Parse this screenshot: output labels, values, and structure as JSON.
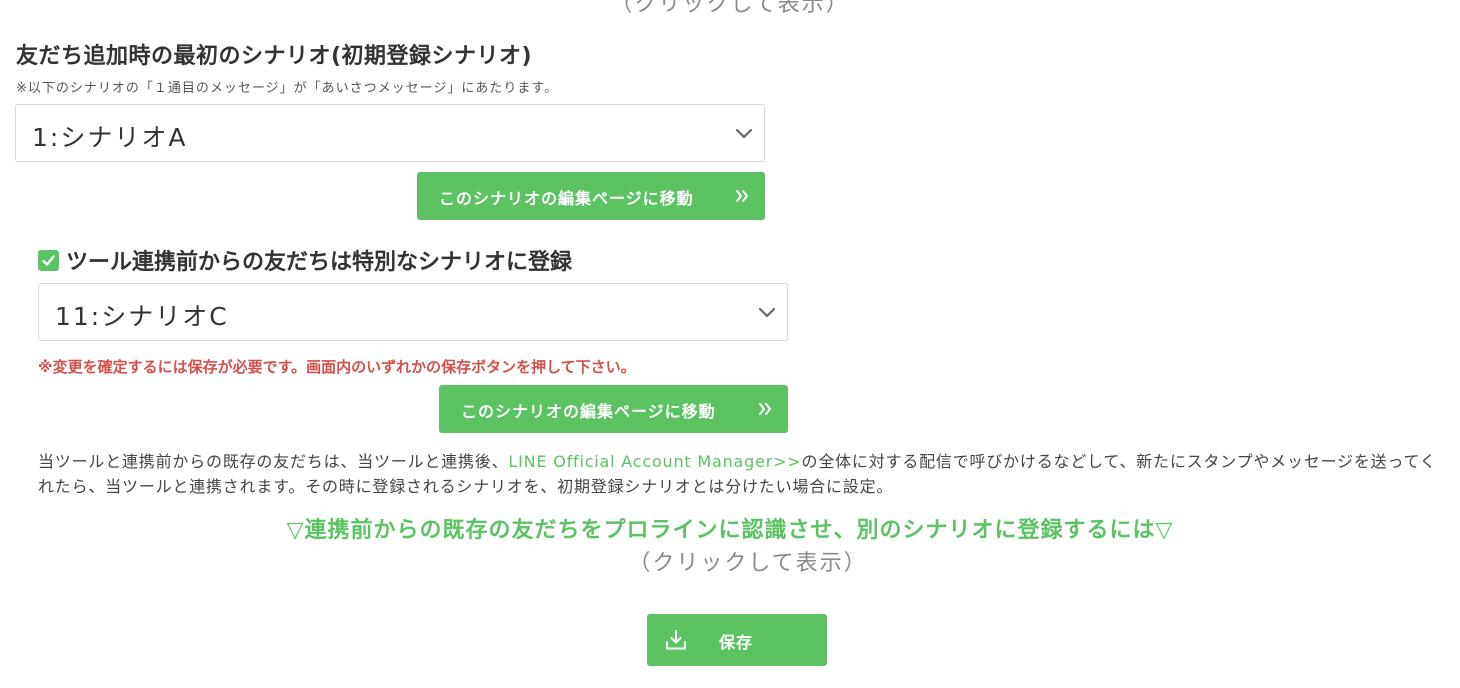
{
  "top_partial_text": "（クリックして表示）",
  "initial_scenario": {
    "title": "友だち追加時の最初のシナリオ(初期登録シナリオ)",
    "note": "※以下のシナリオの「１通目のメッセージ」が「あいさつメッセージ」にあたります。",
    "selected": "1:シナリオA",
    "edit_button_label": "このシナリオの編集ページに移動"
  },
  "special_scenario": {
    "checkbox_label": "ツール連携前からの友だちは特別なシナリオに登録",
    "checked": true,
    "selected": "11:シナリオC",
    "warning": "※変更を確定するには保存が必要です。画面内のいずれかの保存ボタンを押して下さい。",
    "edit_button_label": "このシナリオの編集ページに移動"
  },
  "description": {
    "before_link": "当ツールと連携前からの既存の友だちは、当ツールと連携後、",
    "link_text": "LINE Official Account Manager>>",
    "after_link": "の全体に対する配信で呼びかけるなどして、新たにスタンプやメッセージを送ってくれたら、当ツールと連携されます。その時に登録されるシナリオを、初期登録シナリオとは分けたい場合に設定。"
  },
  "toggle": {
    "title": "▽連携前からの既存の友だちをプロラインに認識させ、別のシナリオに登録するには▽",
    "subtitle": "（クリックして表示）"
  },
  "save_button_label": "保存",
  "colors": {
    "accent_green": "#5cc363",
    "warning_red": "#d4514a"
  },
  "icons": {
    "select_chevron": "chevron-down-icon",
    "button_arrow": "double-chevron-right-icon",
    "checkbox": "check-icon",
    "save": "download-icon"
  }
}
